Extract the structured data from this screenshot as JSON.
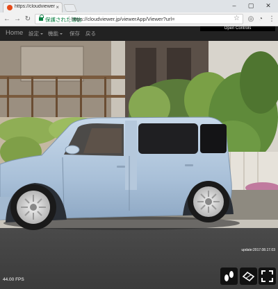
{
  "browser": {
    "tab_title": "https://cloudviewer.jp/",
    "tab_close": "×",
    "secure_label": "保護された通信",
    "url": "https://cloudviewer.jp/viewerApp/Viewer?url=",
    "window_controls": [
      "–",
      "▢",
      "✕"
    ],
    "nav_icons": [
      "back-icon",
      "forward-icon",
      "reload-icon"
    ]
  },
  "navbar": {
    "brand": "Home",
    "items": [
      {
        "label": "設定",
        "dropdown": true
      },
      {
        "label": "機能",
        "dropdown": true
      },
      {
        "label": "保存",
        "dropdown": false
      },
      {
        "label": "戻る",
        "dropdown": false
      }
    ],
    "open_controls": "Open Controls"
  },
  "viewer": {
    "fps": "44.00 FPS",
    "update": "update:2017.08.17.03",
    "control_icons": [
      "walk-icon",
      "car-view-icon",
      "fullscreen-icon"
    ]
  },
  "colors": {
    "navbar_bg": "#222222",
    "car_body": "#b9cde0",
    "secure_green": "#0b8043"
  }
}
